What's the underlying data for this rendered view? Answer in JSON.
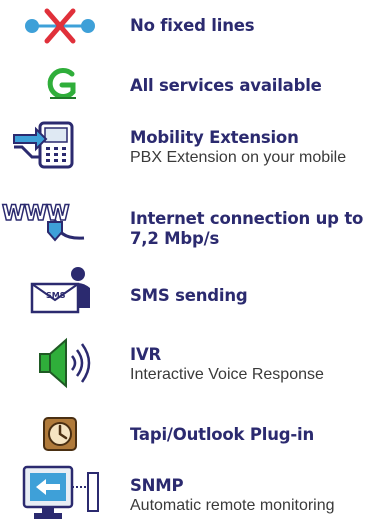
{
  "features": [
    {
      "icon": "network-x-icon",
      "title": "No fixed lines",
      "subtitle": ""
    },
    {
      "icon": "g-logo-icon",
      "title": "All services available",
      "subtitle": ""
    },
    {
      "icon": "mobility-phone-icon",
      "title": "Mobility Extension",
      "subtitle": "PBX Extension on your mobile"
    },
    {
      "icon": "www-cable-icon",
      "title": "Internet connection up to 7,2 Mbp/s",
      "subtitle": ""
    },
    {
      "icon": "sms-envelope-icon",
      "title": "SMS sending",
      "subtitle": "",
      "badge": "SMS"
    },
    {
      "icon": "speaker-icon",
      "title": "IVR",
      "subtitle": "Interactive Voice Response"
    },
    {
      "icon": "outlook-clock-icon",
      "title": "Tapi/Outlook Plug-in",
      "subtitle": ""
    },
    {
      "icon": "monitor-arrow-icon",
      "title": "SNMP",
      "subtitle": "Automatic remote monitoring"
    }
  ],
  "colors": {
    "title": "#2b2a6f",
    "subtitle": "#3a3a3a",
    "accent_red": "#e0303a",
    "accent_blue": "#3ea0d8",
    "accent_green": "#2fae3a"
  }
}
